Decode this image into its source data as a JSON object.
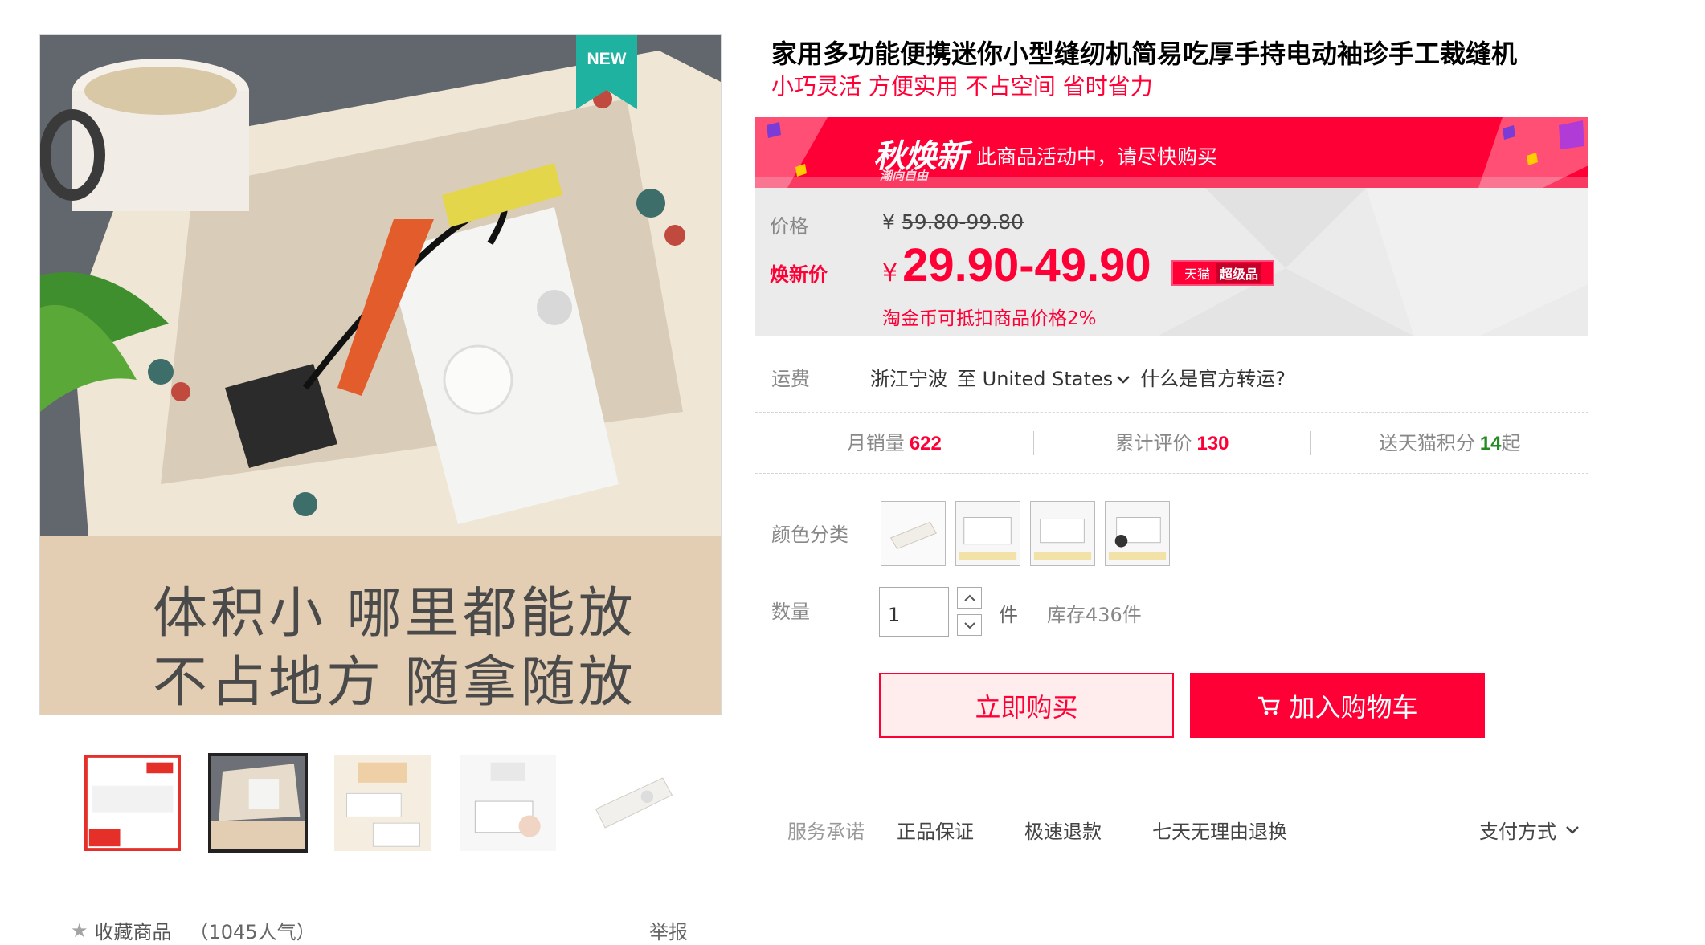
{
  "gallery": {
    "new_badge": "NEW",
    "caption_line1": "体积小  哪里都能放",
    "caption_line2": "不占地方  随拿随放",
    "thumbnails": [
      "thumb-1",
      "thumb-2",
      "thumb-3",
      "thumb-4",
      "thumb-5"
    ],
    "active_thumbnail": 2
  },
  "favorite": {
    "label": "收藏商品",
    "popularity": "（1045人气）"
  },
  "report_label": "举报",
  "product": {
    "title": "家用多功能便携迷你小型缝纫机简易吃厚手持电动袖珍手工裁缝机",
    "subtitle": "小巧灵活 方便实用 不占空间 省时省力"
  },
  "promo": {
    "logo": "秋焕新",
    "logo_sub": "潮向自由",
    "message": "此商品活动中，请尽快购买"
  },
  "price": {
    "label": "价格",
    "currency": "¥",
    "original": "59.80-99.80",
    "promo_label": "焕新价",
    "current": "29.90-49.90",
    "tag_left": "天猫",
    "tag_right": "超级品",
    "coin_note": "淘金币可抵扣商品价格2%"
  },
  "shipping": {
    "label": "运费",
    "from": "浙江宁波",
    "to": "至 United States",
    "question": "什么是官方转运?"
  },
  "stats": {
    "monthly_sales_label": "月销量",
    "monthly_sales": "622",
    "reviews_label": "累计评价",
    "reviews": "130",
    "points_label": "送天猫积分",
    "points": "14",
    "points_suffix": "起"
  },
  "options": {
    "color_label": "颜色分类",
    "colors": [
      "style-1",
      "style-2",
      "style-3",
      "style-4"
    ]
  },
  "quantity": {
    "label": "数量",
    "value": "1",
    "unit": "件",
    "stock": "库存436件"
  },
  "actions": {
    "buy_now": "立即购买",
    "add_to_cart": "加入购物车"
  },
  "service": {
    "label": "服务承诺",
    "items": [
      "正品保证",
      "极速退款",
      "七天无理由退换"
    ],
    "payment": "支付方式"
  },
  "colors": {
    "accent": "#ff0036",
    "price_box_bg": "#ebebeb",
    "green_points": "#228b22"
  }
}
